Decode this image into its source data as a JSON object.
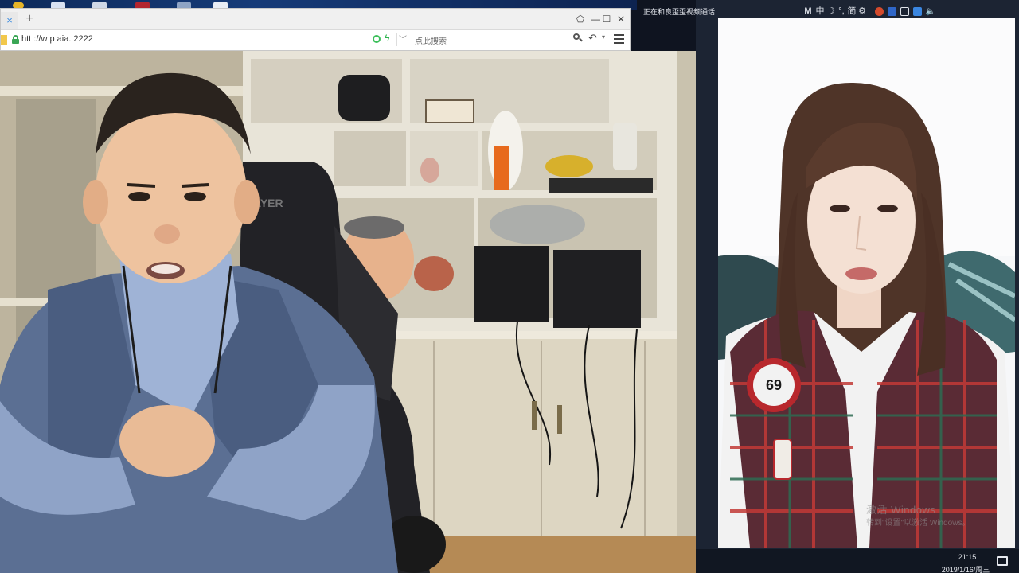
{
  "browser": {
    "tab_close_glyph": "×",
    "new_tab_glyph": "+",
    "window_buttons": {
      "restore": "⬠",
      "minimize": "—",
      "maximize": "☐",
      "close": "✕"
    },
    "url": "htt  ://w    p   aia.  2222",
    "search_placeholder": "点此搜索",
    "undo_glyph": "↶",
    "caret_glyph": "▾"
  },
  "call": {
    "window_title": "正在和良歪歪视频通话"
  },
  "watermark": {
    "line1": "激活 Windows",
    "line2": "转到\"设置\"以激活 Windows。"
  },
  "taskbar": {
    "ime_mode": "M",
    "ime_lang": "中",
    "ime_moon": "☽",
    "ime_punct": "°,",
    "ime_simplified": "简",
    "settings_glyph": "⚙",
    "volume_glyph": "🔈",
    "time": "21:15",
    "date": "2019/1/16/周三"
  },
  "colors": {
    "accent_green": "#3aa655",
    "taskbar_bg": "#111722",
    "call_pane_bg": "#1c2433"
  }
}
